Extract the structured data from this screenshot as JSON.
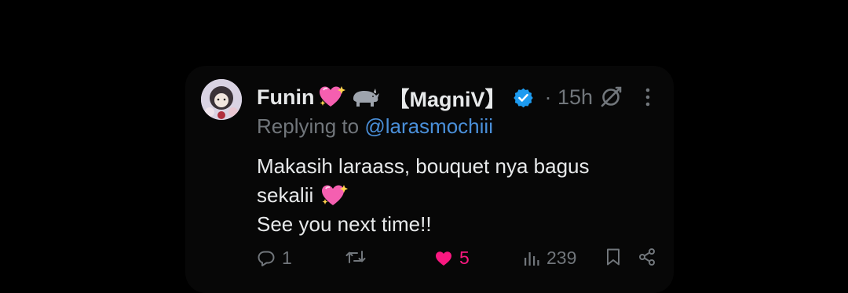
{
  "tweet": {
    "author_name": "Funin",
    "name_emojis": [
      "sparkling-heart-icon",
      "rhinoceros-icon"
    ],
    "author_suffix": "【MagniV】",
    "separator_time": "· 15h",
    "replying_prefix": "Replying to",
    "replying_handle": "@larasmochiii",
    "lines": [
      "Makasih laraass, bouquet nya bagus",
      "sekalii",
      "See you next time!!"
    ],
    "line2_emoji": "sparkling-heart-icon"
  },
  "actions": {
    "replies": "1",
    "retweets": "",
    "likes": "5",
    "views": "239"
  },
  "colors": {
    "background": "#000000",
    "card": "#070707",
    "text": "#e7e9ea",
    "secondary": "#71767b",
    "link": "#4a8fd9",
    "like": "#f91880",
    "verified": "#1d9bf0"
  }
}
